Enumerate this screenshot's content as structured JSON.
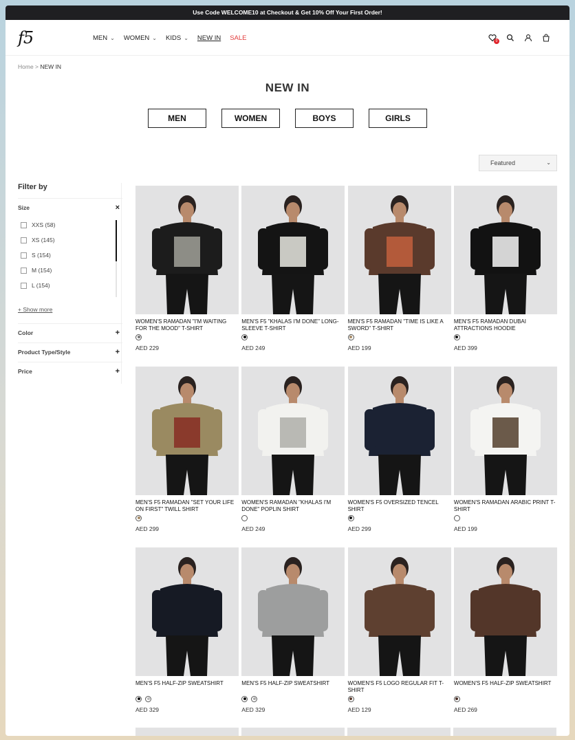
{
  "promo": "Use Code WELCOME10 at Checkout & Get 10% Off Your First Order!",
  "logo": "f5",
  "nav": [
    {
      "label": "MEN",
      "dropdown": true
    },
    {
      "label": "WOMEN",
      "dropdown": true
    },
    {
      "label": "KIDS",
      "dropdown": true
    },
    {
      "label": "NEW IN",
      "dropdown": false
    },
    {
      "label": "SALE",
      "dropdown": false
    }
  ],
  "wishlist_count": "0",
  "breadcrumb": {
    "home": "Home",
    "sep": " > ",
    "current": "NEW IN"
  },
  "page_title": "NEW IN",
  "category_buttons": [
    "MEN",
    "WOMEN",
    "BOYS",
    "GIRLS"
  ],
  "sort": {
    "value": "Featured"
  },
  "filter": {
    "title": "Filter by",
    "size_label": "Size",
    "sizes": [
      "XXS (58)",
      "XS (145)",
      "S (154)",
      "M (154)",
      "L (154)"
    ],
    "show_more": "+ Show more",
    "color_label": "Color",
    "type_label": "Product Type/Style",
    "price_label": "Price"
  },
  "products": [
    {
      "name": "WOMEN'S RAMADAN \"I'M WAITING FOR THE MOOD\" T-SHIRT",
      "price": "AED 229",
      "swatches": [
        "#777"
      ],
      "bg": "#e2e2e3",
      "garment": "#1c1c1c",
      "print": "#8d8d86"
    },
    {
      "name": "MEN'S F5 \"KHALAS I'M DONE\" LONG-SLEEVE T-SHIRT",
      "price": "AED 249",
      "swatches": [
        "#111"
      ],
      "bg": "#e2e2e3",
      "garment": "#141414",
      "print": "#c9c9c3"
    },
    {
      "name": "MEN'S F5 RAMADAN \"TIME IS LIKE A SWORD\" T-SHIRT",
      "price": "AED 199",
      "swatches": [
        "#a58a66"
      ],
      "bg": "#e2e2e3",
      "garment": "#5a3a2c",
      "print": "#b35a3a"
    },
    {
      "name": "MEN'S F5 RAMADAN DUBAI ATTRACTIONS HOODIE",
      "price": "AED 399",
      "swatches": [
        "#111"
      ],
      "bg": "#e2e2e3",
      "garment": "#121212",
      "print": "#d4d4d4"
    },
    {
      "name": "MEN'S F5 RAMADAN \"SET YOUR LIFE ON FIRST\" TWILL SHIRT",
      "price": "AED 299",
      "swatches": [
        "#a58a66"
      ],
      "bg": "#e2e2e3",
      "garment": "#9a8a61",
      "print": "#8a3a2c"
    },
    {
      "name": "WOMEN'S RAMADAN \"KHALAS I'M DONE\" POPLIN SHIRT",
      "price": "AED 249",
      "swatches": [
        "#fff"
      ],
      "bg": "#e2e2e3",
      "garment": "#f2f2ef",
      "print": "#b9b9b4"
    },
    {
      "name": "WOMEN'S F5 OVERSIZED TENCEL SHIRT",
      "price": "AED 299",
      "swatches": [
        "#111"
      ],
      "bg": "#e2e2e3",
      "garment": "#1b2233",
      "print": ""
    },
    {
      "name": "WOMEN'S RAMADAN ARABIC PRINT T-SHIRT",
      "price": "AED 199",
      "swatches": [
        "#fff"
      ],
      "bg": "#e2e2e3",
      "garment": "#f4f4f2",
      "print": "#6b5a4a"
    },
    {
      "name": "MEN'S F5 HALF-ZIP SWEATSHIRT",
      "price": "AED 329",
      "swatches": [
        "#111",
        "#bbb"
      ],
      "bg": "#e2e2e3",
      "garment": "#161a24",
      "print": ""
    },
    {
      "name": "MEN'S F5 HALF-ZIP SWEATSHIRT",
      "price": "AED 329",
      "swatches": [
        "#111",
        "#aaa"
      ],
      "bg": "#e2e2e3",
      "garment": "#9d9e9e",
      "print": ""
    },
    {
      "name": "WOMEN'S F5 LOGO REGULAR FIT T-SHIRT",
      "price": "AED 129",
      "swatches": [
        "#5a3a2c"
      ],
      "bg": "#e2e2e3",
      "garment": "#5e4030",
      "print": ""
    },
    {
      "name": "WOMEN'S F5 HALF-ZIP SWEATSHIRT",
      "price": "AED 269",
      "swatches": [
        "#4a2f26"
      ],
      "bg": "#e2e2e3",
      "garment": "#533629",
      "print": ""
    }
  ]
}
